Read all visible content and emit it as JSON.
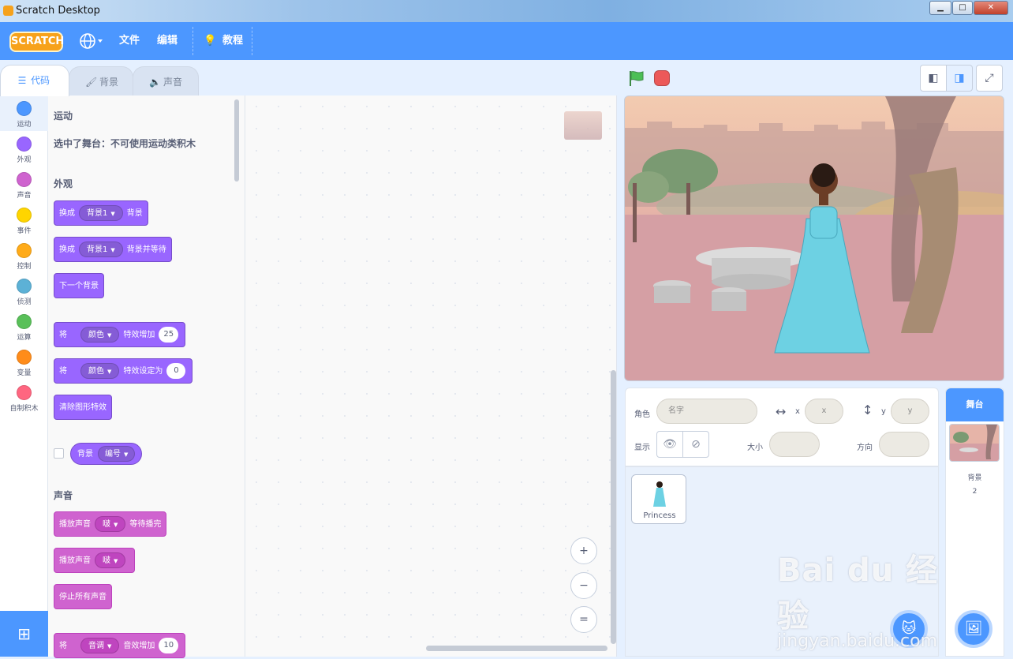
{
  "window": {
    "title": "Scratch Desktop",
    "min": "▁",
    "max": "□",
    "close": "✕"
  },
  "menubar": {
    "logo": "SCRATCH",
    "items": [
      {
        "label": "文件"
      },
      {
        "label": "编辑"
      },
      {
        "label": "教程"
      }
    ]
  },
  "tabs": [
    {
      "label": "代码",
      "icon": "code-icon"
    },
    {
      "label": "背景",
      "icon": "brush-icon"
    },
    {
      "label": "声音",
      "icon": "speaker-icon"
    }
  ],
  "categories": [
    {
      "label": "运动",
      "color": "#4c97ff"
    },
    {
      "label": "外观",
      "color": "#9966ff"
    },
    {
      "label": "声音",
      "color": "#cf63cf"
    },
    {
      "label": "事件",
      "color": "#ffd500"
    },
    {
      "label": "控制",
      "color": "#ffab19"
    },
    {
      "label": "侦测",
      "color": "#5cb1d6"
    },
    {
      "label": "运算",
      "color": "#59c059"
    },
    {
      "label": "变量",
      "color": "#ff8c1a"
    },
    {
      "label": "自制积木",
      "color": "#ff6680"
    }
  ],
  "palette": {
    "motion_title": "运动",
    "motion_note": "选中了舞台：不可使用运动类积木",
    "looks_title": "外观",
    "sound_title": "声音",
    "blocks": {
      "switch_backdrop": {
        "a": "换成",
        "dd": "背景1",
        "b": "背景"
      },
      "switch_backdrop_wait": {
        "a": "换成",
        "dd": "背景1",
        "b": "背景并等待"
      },
      "next_backdrop": {
        "a": "下一个背景"
      },
      "change_effect": {
        "a": "将",
        "dd": "颜色",
        "b": "特效增加",
        "num": "25"
      },
      "set_effect": {
        "a": "将",
        "dd": "颜色",
        "b": "特效设定为",
        "num": "0"
      },
      "clear_effects": {
        "a": "清除图形特效"
      },
      "backdrop_reporter": {
        "a": "背景",
        "dd": "编号"
      },
      "play_until_done": {
        "a": "播放声音",
        "dd": "啵",
        "b": "等待播完"
      },
      "start_sound": {
        "a": "播放声音",
        "dd": "啵"
      },
      "stop_all_sounds": {
        "a": "停止所有声音"
      },
      "change_pitch": {
        "a": "将",
        "dd": "音调",
        "b": "音效增加",
        "num": "10"
      }
    }
  },
  "zoom": {
    "in": "+",
    "out": "−",
    "reset": "="
  },
  "sprite_info": {
    "sprite_label": "角色",
    "name_placeholder": "名字",
    "x_label": "x",
    "x_placeholder": "x",
    "y_label": "y",
    "y_placeholder": "y",
    "show_label": "显示",
    "size_label": "大小",
    "direction_label": "方向"
  },
  "sprites": [
    {
      "name": "Princess"
    }
  ],
  "stage_pane": {
    "header": "舞台",
    "backdrops_label": "背景",
    "backdrops_count": "2"
  },
  "watermark": {
    "line1": "Bai du 经验",
    "line2": "jingyan.baidu.com"
  },
  "colors": {
    "accent": "#4c97ff",
    "looks": "#9966ff",
    "sound": "#cf63cf",
    "stop": "#ec5959",
    "flag": "#4cbf56"
  }
}
